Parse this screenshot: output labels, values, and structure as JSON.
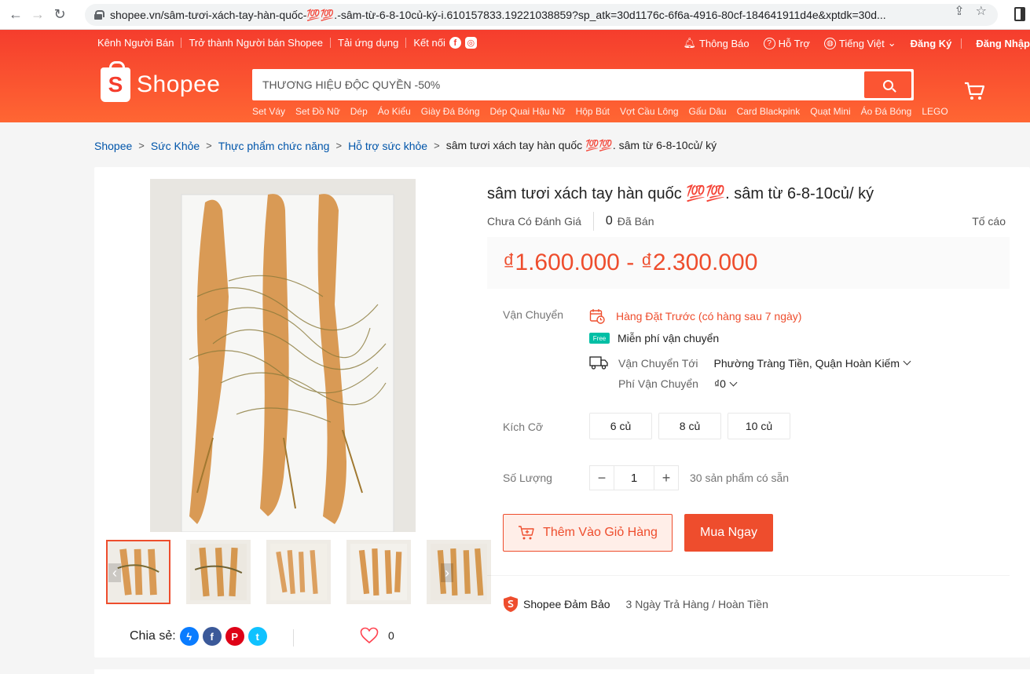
{
  "browser": {
    "url": "shopee.vn/sâm-tươi-xách-tay-hàn-quốc-💯💯.-sâm-từ-6-8-10củ-ký-i.610157833.19221038859?sp_atk=30d1176c-6f6a-4916-80cf-184641911d4e&xptdk=30d..."
  },
  "topnav": {
    "left": [
      "Kênh Người Bán",
      "Trở thành Người bán Shopee",
      "Tải ứng dụng",
      "Kết nối"
    ],
    "notifications": "Thông Báo",
    "help": "Hỗ Trợ",
    "language": "Tiếng Việt",
    "register": "Đăng Ký",
    "login": "Đăng Nhập"
  },
  "header": {
    "logo_text": "Shopee",
    "search_placeholder": "THƯƠNG HIỆU ĐỘC QUYỀN -50%",
    "keywords": [
      "Set Váy",
      "Set Đồ Nữ",
      "Dép",
      "Áo Kiểu",
      "Giày Đá Bóng",
      "Dép Quai Hậu Nữ",
      "Hộp Bút",
      "Vợt Cầu Lông",
      "Gấu Dâu",
      "Card Blackpink",
      "Quạt Mini",
      "Áo Đá Bóng",
      "LEGO"
    ]
  },
  "breadcrumb": {
    "items": [
      "Shopee",
      "Sức Khỏe",
      "Thực phẩm chức năng",
      "Hỗ trợ sức khỏe"
    ],
    "current": "sâm tươi xách tay hàn quốc 💯💯. sâm từ 6-8-10củ/ ký"
  },
  "product": {
    "title": "sâm tươi xách tay hàn quốc 💯💯. sâm từ 6-8-10củ/ ký",
    "rating_text": "Chưa Có Đánh Giá",
    "sold_count": "0",
    "sold_label": "Đã Bán",
    "report": "Tố cáo",
    "price": "₫1.600.000 - ₫2.300.000",
    "shipping": {
      "label": "Vận Chuyển",
      "preorder": "Hàng Đặt Trước (có hàng sau 7 ngày)",
      "free_badge": "Free",
      "free_shipping": "Miễn phí vận chuyển",
      "ship_to_label": "Vận Chuyển Tới",
      "ship_to_value": "Phường Tràng Tiền, Quận Hoàn Kiếm",
      "fee_label": "Phí Vận Chuyển",
      "fee_value": "₫0"
    },
    "size_label": "Kích Cỡ",
    "sizes": [
      "6 củ",
      "8 củ",
      "10 củ"
    ],
    "quantity_label": "Số Lượng",
    "quantity": "1",
    "quantity_minus": "−",
    "quantity_plus": "+",
    "stock": "30 sản phẩm có sẵn",
    "add_to_cart": "Thêm Vào Giỏ Hàng",
    "buy_now": "Mua Ngay",
    "guarantee_name": "Shopee Đảm Bảo",
    "guarantee_desc": "3 Ngày Trả Hàng / Hoàn Tiền",
    "share_label": "Chia sẻ:",
    "likes": "0"
  },
  "colors": {
    "brand": "#ee4d2d",
    "header_gradient": [
      "#f53d2d",
      "#ff6633"
    ],
    "link": "#0055aa"
  }
}
